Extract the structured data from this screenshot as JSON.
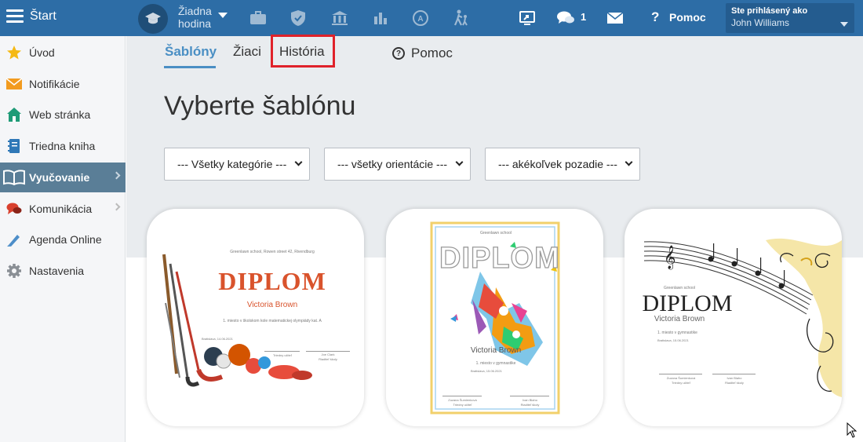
{
  "topbar": {
    "start_label": "Štart",
    "lesson_line1": "Žiadna",
    "lesson_line2": "hodina",
    "icons": [
      "graduation-cap-icon",
      "briefcase-icon",
      "shield-icon",
      "bank-icon",
      "bar-chart-icon",
      "grade-icon",
      "walking-child-icon",
      "screen-share-icon",
      "chat-icon",
      "mail-icon"
    ],
    "messages_count": "1",
    "help_label": "Pomoc",
    "user_caption": "Ste prihlásený ako",
    "user_name": "John Williams",
    "color": "#2d6da6"
  },
  "sidebar": {
    "items": [
      {
        "label": "Úvod",
        "icon": "star-icon"
      },
      {
        "label": "Notifikácie",
        "icon": "envelope-icon"
      },
      {
        "label": "Web stránka",
        "icon": "house-icon"
      },
      {
        "label": "Triedna kniha",
        "icon": "notebook-icon"
      },
      {
        "label": "Vyučovanie",
        "icon": "open-book-icon",
        "active": true
      },
      {
        "label": "Komunikácia",
        "icon": "speech-bubbles-icon"
      },
      {
        "label": "Agenda Online",
        "icon": "pen-icon"
      },
      {
        "label": "Nastavenia",
        "icon": "gear-icon"
      }
    ]
  },
  "tabs": {
    "templates": "Šablóny",
    "students": "Žiaci",
    "history": "História",
    "help": "Pomoc"
  },
  "heading": "Vyberte šablónu",
  "filters": {
    "category": "--- Všetky kategórie ---",
    "orientation": "--- všetky orientácie ---",
    "background": "--- akékoľvek pozadie ---"
  },
  "cards": [
    {
      "school": "Greenlawn school, Rowen street 42, Rivendburg",
      "title": "DIPLOM",
      "name": "Victoria Brown",
      "line": "1. miesto v školskom kole matematickej olympiády kat. A",
      "date": "Bratislava, 14.06.2021",
      "sig_left": "Triedny učiteľ",
      "sig_right_name": "Joe Clark",
      "sig_right_role": "Riaditeľ školy",
      "title_color": "#d9532c"
    },
    {
      "school": "Greenlawn school",
      "title": "DIPLOM",
      "name": "Victoria Brown",
      "line": "1. miesto v gymnastike",
      "date": "Bratislava, 15.06.2021",
      "sig_left_name": "Zuzana Šumienková",
      "sig_left": "Triedny učiteľ",
      "sig_right_name": "Ivan Blaho",
      "sig_right_role": "Riaditeľ školy"
    },
    {
      "school": "Greenlawn school",
      "title": "DIPLOM",
      "name": "Victoria Brown",
      "line": "1. miesto v gymnastike",
      "date": "Bratislava, 15.06.2021",
      "sig_left_name": "Zuzana Šumienková",
      "sig_left": "Triedny učiteľ",
      "sig_right_name": "Ivan Blaho",
      "sig_right_role": "Riaditeľ školy"
    }
  ]
}
